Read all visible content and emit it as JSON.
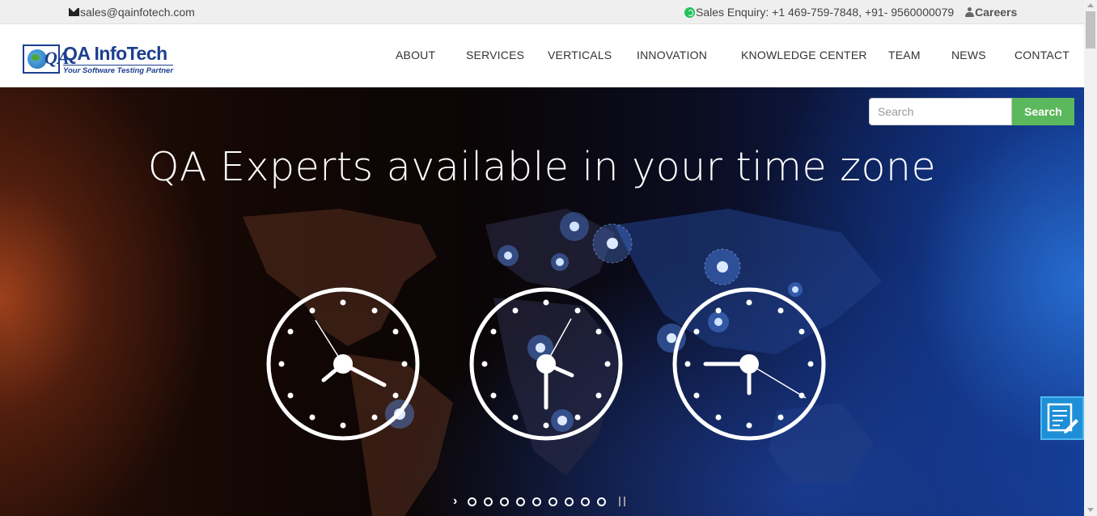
{
  "topbar": {
    "email": "sales@qainfotech.com",
    "sales_enquiry": "Sales Enquiry: +1 469-759-7848, +91- 9560000079",
    "careers": "Careers"
  },
  "brand": {
    "mark_letters": "QA",
    "name": "QA InfoTech",
    "tagline": "Your Software Testing Partner",
    "color": "#1c3f8f"
  },
  "nav": {
    "items": [
      "ABOUT",
      "SERVICES",
      "VERTICALS",
      "INNOVATION",
      "KNOWLEDGE CENTER",
      "TEAM",
      "NEWS",
      "CONTACT"
    ]
  },
  "search": {
    "placeholder": "Search",
    "button_label": "Search",
    "button_color": "#5cb85c"
  },
  "hero": {
    "headline": "QA Experts available in your time zone",
    "slide_count": 9,
    "active_slide": 1
  },
  "icons": {
    "email": "envelope-icon",
    "phone": "whatsapp-icon",
    "careers": "user-icon",
    "float": "form-edit-icon"
  }
}
